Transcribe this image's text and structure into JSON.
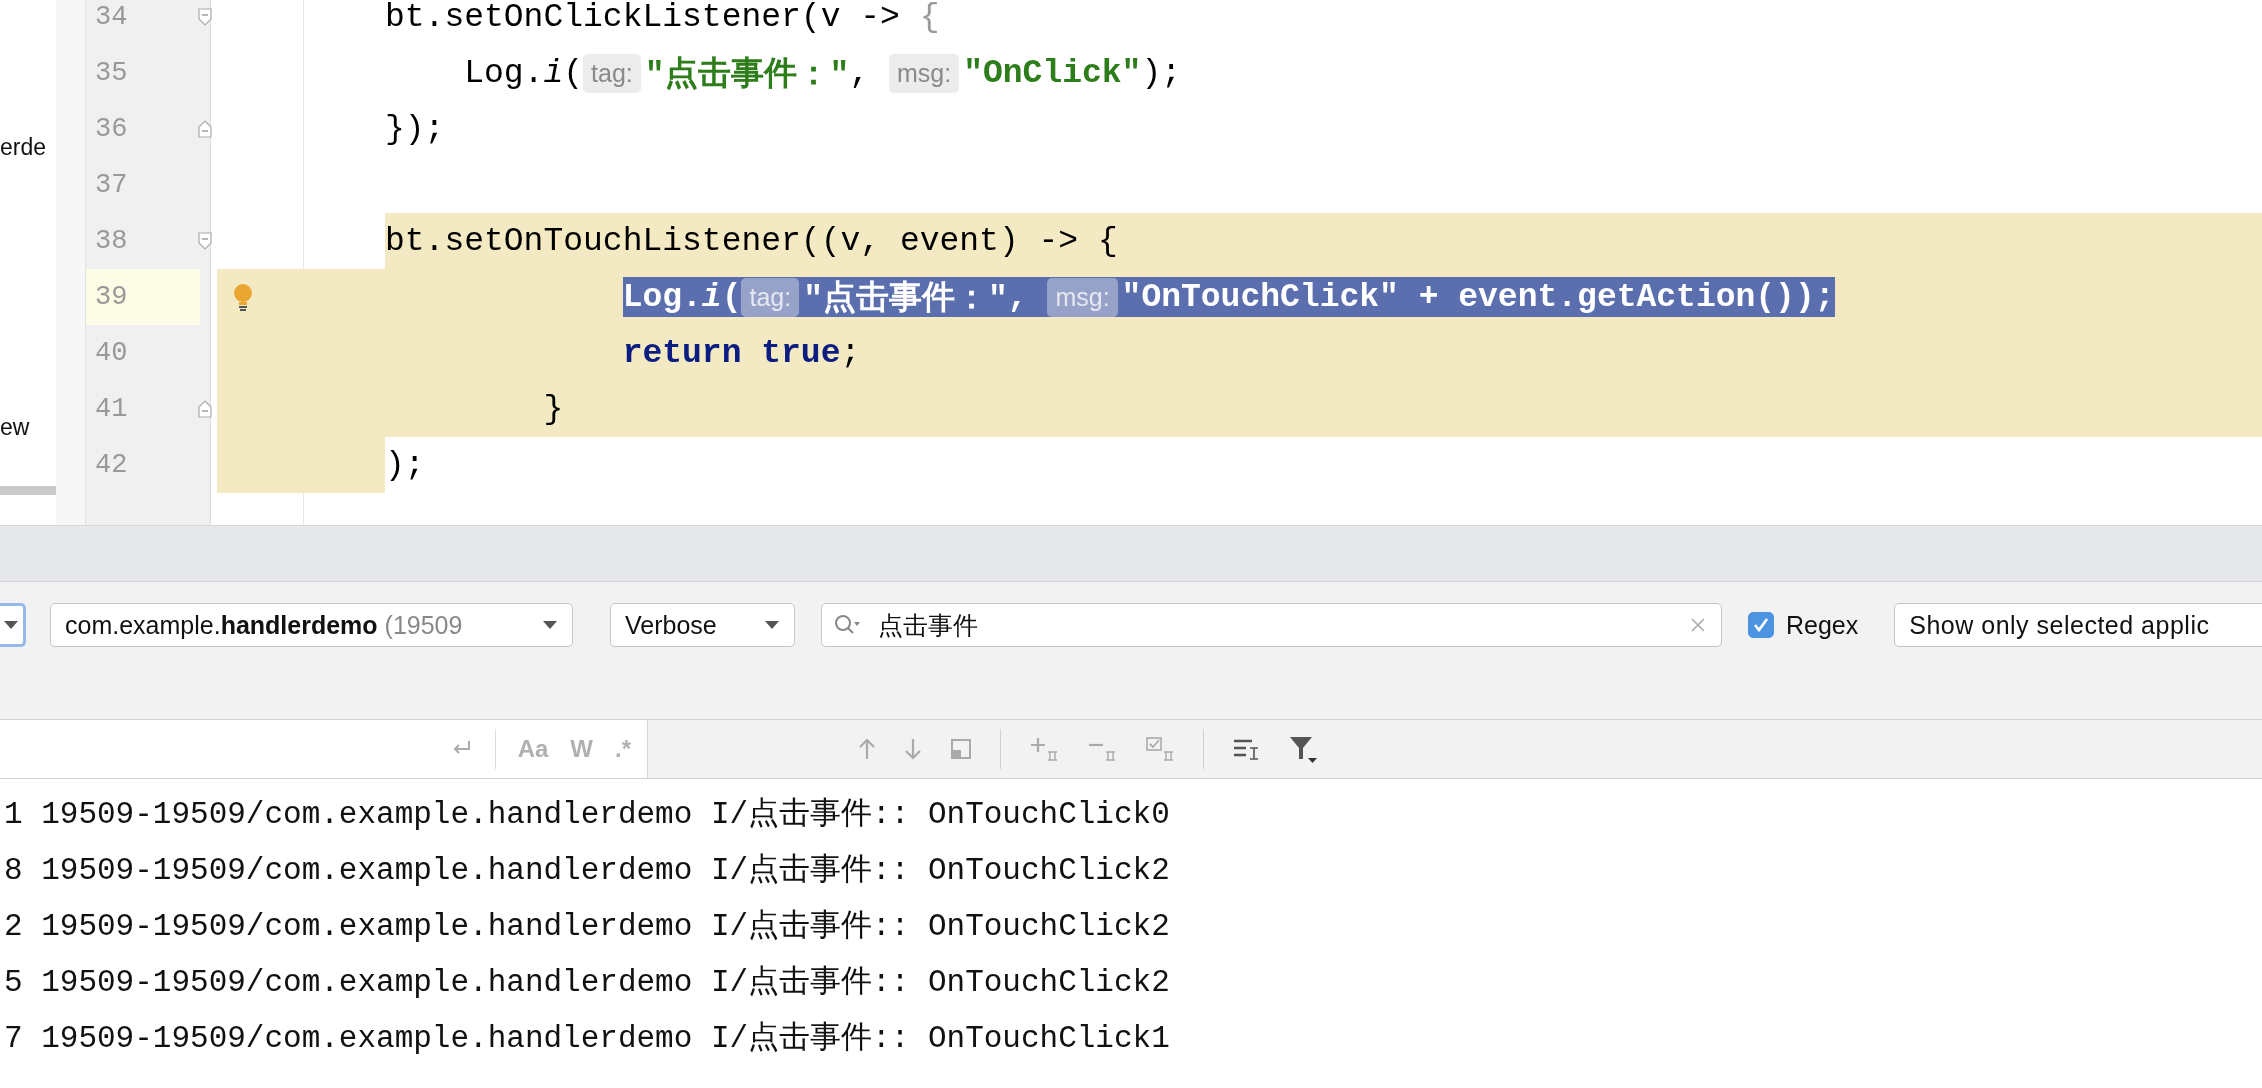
{
  "sidebar": {
    "items": [
      "erde",
      "ew"
    ]
  },
  "editor": {
    "lines": [
      {
        "number": "34",
        "fold_start": true,
        "fold_end": false,
        "current": false,
        "highlighted": false,
        "gutter_highlight": false,
        "bulb": false,
        "selected": false,
        "tokens": [
          {
            "kind": "plain",
            "text": "bt.setOnClickListener(v -> "
          },
          {
            "kind": "dim",
            "text": "{"
          }
        ]
      },
      {
        "number": "35",
        "fold_start": false,
        "fold_end": false,
        "current": false,
        "highlighted": false,
        "gutter_highlight": false,
        "bulb": false,
        "selected": false,
        "tokens": [
          {
            "kind": "plain",
            "text": "    Log."
          },
          {
            "kind": "italic",
            "text": "i"
          },
          {
            "kind": "plain",
            "text": "("
          },
          {
            "kind": "hint",
            "text": "tag:"
          },
          {
            "kind": "string",
            "text": "\"点击事件：\""
          },
          {
            "kind": "plain",
            "text": ", "
          },
          {
            "kind": "hint",
            "text": "msg:"
          },
          {
            "kind": "string",
            "text": "\"OnClick\""
          },
          {
            "kind": "plain",
            "text": ");"
          }
        ]
      },
      {
        "number": "36",
        "fold_start": false,
        "fold_end": true,
        "current": false,
        "highlighted": false,
        "gutter_highlight": false,
        "bulb": false,
        "selected": false,
        "tokens": [
          {
            "kind": "plain",
            "text": "});"
          }
        ]
      },
      {
        "number": "37",
        "fold_start": false,
        "fold_end": false,
        "current": false,
        "highlighted": false,
        "gutter_highlight": false,
        "bulb": false,
        "selected": false
      },
      {
        "number": "38",
        "fold_start": true,
        "fold_end": false,
        "current": false,
        "highlighted": true,
        "gutter_highlight": false,
        "bulb": false,
        "selected": false,
        "tokens": [
          {
            "kind": "plain",
            "text": "bt.setOnTouchListener((v, event) -> {"
          }
        ]
      },
      {
        "number": "39",
        "fold_start": false,
        "fold_end": false,
        "current": true,
        "highlighted": true,
        "gutter_highlight": true,
        "bulb": true,
        "selected": true,
        "tokens": [
          {
            "kind": "plain",
            "text": "            Log."
          },
          {
            "kind": "italic",
            "text": "i"
          },
          {
            "kind": "plain",
            "text": "("
          },
          {
            "kind": "hint",
            "text": "tag:"
          },
          {
            "kind": "string",
            "text": "\"点击事件：\""
          },
          {
            "kind": "plain",
            "text": ", "
          },
          {
            "kind": "hint",
            "text": "msg:"
          },
          {
            "kind": "string",
            "text": "\"OnTouchClick\""
          },
          {
            "kind": "plain",
            "text": " + event.getAction());"
          }
        ]
      },
      {
        "number": "40",
        "fold_start": false,
        "fold_end": false,
        "current": false,
        "highlighted": true,
        "gutter_highlight": true,
        "bulb": false,
        "selected": false,
        "tokens": [
          {
            "kind": "keyword",
            "text": "            return true"
          },
          {
            "kind": "plain",
            "text": ";"
          }
        ]
      },
      {
        "number": "41",
        "fold_start": false,
        "fold_end": true,
        "current": false,
        "highlighted": true,
        "gutter_highlight": true,
        "bulb": false,
        "selected": false,
        "tokens": [
          {
            "kind": "plain",
            "text": "        }"
          }
        ]
      },
      {
        "number": "42",
        "fold_start": false,
        "fold_end": false,
        "current": false,
        "highlighted": false,
        "gutter_highlight": true,
        "bulb": false,
        "selected": false,
        "tokens": [
          {
            "kind": "plain",
            "text": ");"
          }
        ]
      }
    ]
  },
  "logcat": {
    "device_dropdown": {
      "focused": true
    },
    "process_dropdown": {
      "value": "com.example.**handlerdemo**",
      "detail": "(19509"
    },
    "level_dropdown": {
      "value": "Verbose"
    },
    "search": {
      "value": "点击事件"
    },
    "regex": {
      "label": "Regex",
      "checked": true
    },
    "filter_dropdown": {
      "value": "Show only selected applic"
    },
    "search_options": [
      {
        "label": "Aa"
      },
      {
        "label": "W"
      },
      {
        "label": ".*"
      }
    ],
    "log_lines": [
      "1 19509-19509/com.example.handlerdemo I/点击事件:: OnTouchClick0",
      "8 19509-19509/com.example.handlerdemo I/点击事件:: OnTouchClick2",
      "2 19509-19509/com.example.handlerdemo I/点击事件:: OnTouchClick2",
      "5 19509-19509/com.example.handlerdemo I/点击事件:: OnTouchClick2",
      "7 19509-19509/com.example.handlerdemo I/点击事件:: OnTouchClick1"
    ]
  }
}
